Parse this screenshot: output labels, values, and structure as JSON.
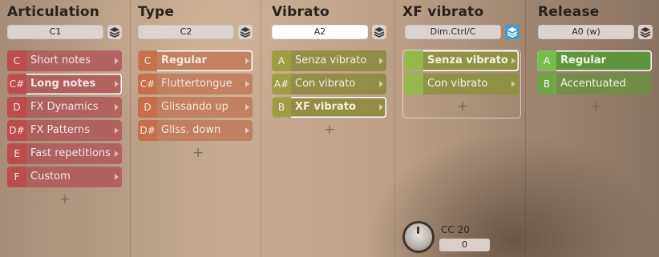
{
  "columns": [
    {
      "title": "Articulation",
      "selector": "C1",
      "items": [
        {
          "key": "C",
          "label": "Short notes",
          "selected": false
        },
        {
          "key": "C#",
          "label": "Long notes",
          "selected": true
        },
        {
          "key": "D",
          "label": "FX Dynamics",
          "selected": false
        },
        {
          "key": "D#",
          "label": "FX Patterns",
          "selected": false
        },
        {
          "key": "E",
          "label": "Fast repetitions",
          "selected": false
        },
        {
          "key": "F",
          "label": "Custom",
          "selected": false
        }
      ]
    },
    {
      "title": "Type",
      "selector": "C2",
      "items": [
        {
          "key": "C",
          "label": "Regular",
          "selected": true
        },
        {
          "key": "C#",
          "label": "Fluttertongue",
          "selected": false
        },
        {
          "key": "D",
          "label": "Glissando up",
          "selected": false
        },
        {
          "key": "D#",
          "label": "Gliss. down",
          "selected": false
        }
      ]
    },
    {
      "title": "Vibrato",
      "selector": "A2",
      "items": [
        {
          "key": "A",
          "label": "Senza vibrato",
          "selected": false
        },
        {
          "key": "A#",
          "label": "Con vibrato",
          "selected": false
        },
        {
          "key": "B",
          "label": "XF vibrato",
          "selected": true
        }
      ]
    },
    {
      "title": "XF vibrato",
      "selector": "Dim.Ctrl/C",
      "items": [
        {
          "key": "",
          "label": "Senza vibrato",
          "selected": true
        },
        {
          "key": "",
          "label": "Con vibrato",
          "selected": false
        }
      ],
      "controller": {
        "label": "CC 20",
        "value": "0"
      }
    },
    {
      "title": "Release",
      "selector": "A0 (w)",
      "items": [
        {
          "key": "A",
          "label": "Regular",
          "selected": true
        },
        {
          "key": "B",
          "label": "Accentuated",
          "selected": false
        }
      ]
    }
  ],
  "add_symbol": "+",
  "icons": {
    "layers": "layers-icon",
    "submenu": "chevron-right-icon",
    "knob": "knob-icon"
  },
  "colors": {
    "articulation": "#b05656",
    "type": "#be7656",
    "vibrato": "#8c8a3e",
    "xf_vibrato": "#96b84c",
    "release": "#6e8e42",
    "layers_active": "#3f9ad7"
  }
}
